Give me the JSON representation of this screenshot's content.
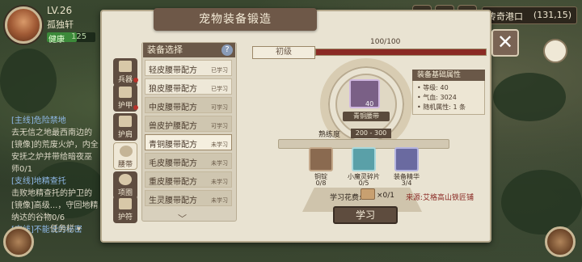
{
  "hud": {
    "level": "LV.26",
    "name": "孤独轩",
    "hp_tag": "健康",
    "hp_value": "125",
    "hp_fraction": 0.62
  },
  "location": {
    "name": "传奇港口",
    "coords": "(131,15)"
  },
  "quests": [
    {
      "title": "[主线]危险禁地",
      "text": "去无信之地最西南边的[镜像]的荒废火炉，内全安抚之炉并带给暗夜巫师0/1"
    },
    {
      "title": "[支线]地精查托",
      "text": "击败地精查托的护卫的[镜像]高级...，守回地精纳达的谷物0/6"
    },
    {
      "title": "[支线]不能说的秘密",
      "text": ""
    }
  ],
  "quest_more": "任务栏 ▾",
  "dialog": {
    "title": "宠物装备锻造",
    "close_label": "✕",
    "tabs": [
      {
        "label": "兵器",
        "icon": "weapon-icon"
      },
      {
        "label": "护甲",
        "icon": "armor-icon"
      },
      {
        "label": "护肩",
        "icon": "shoulder-icon"
      },
      {
        "label": "腰带",
        "icon": "belt-icon",
        "active": true
      },
      {
        "label": "项圈",
        "icon": "collar-icon"
      },
      {
        "label": "护符",
        "icon": "amulet-icon"
      }
    ],
    "list_header": "装备选择",
    "help_label": "?",
    "recipes": [
      {
        "name": "轻皮腰带配方",
        "status": "已学习"
      },
      {
        "name": "狼皮腰带配方",
        "status": "已学习"
      },
      {
        "name": "中皮腰带配方",
        "status": "可学习"
      },
      {
        "name": "兽皮护腰配方",
        "status": "可学习"
      },
      {
        "name": "青铜腰带配方",
        "status": "未学习"
      },
      {
        "name": "毛皮腰带配方",
        "status": "未学习"
      },
      {
        "name": "重皮腰带配方",
        "status": "未学习"
      },
      {
        "name": "生灵腰带配方",
        "status": "未学习"
      }
    ],
    "scroll_arrow": "﹀",
    "grade_label": "初级",
    "progress_text": "100/100",
    "progress_fraction": 1.0,
    "item": {
      "level": "40",
      "name": "青铜腰带"
    },
    "attr_header": "装备基础属性",
    "attrs": [
      "• 等级: 40",
      "• 气血: 3024",
      "• 随机属性: 1 条"
    ],
    "proficiency_label": "熟练度",
    "proficiency_value": "200 - 300",
    "materials": [
      {
        "name": "铜锭",
        "count": "0/8",
        "color": "#8a6a50"
      },
      {
        "name": "小魔灵碎片",
        "count": "0/5",
        "color": "#5aa0a8"
      },
      {
        "name": "装备精华",
        "count": "3/4",
        "color": "#6a6aa0"
      }
    ],
    "cost_label": "学习花费:",
    "cost_count": "×0/1",
    "source_text": "来源:艾格高山铁匠铺",
    "learn_button": "学习"
  }
}
